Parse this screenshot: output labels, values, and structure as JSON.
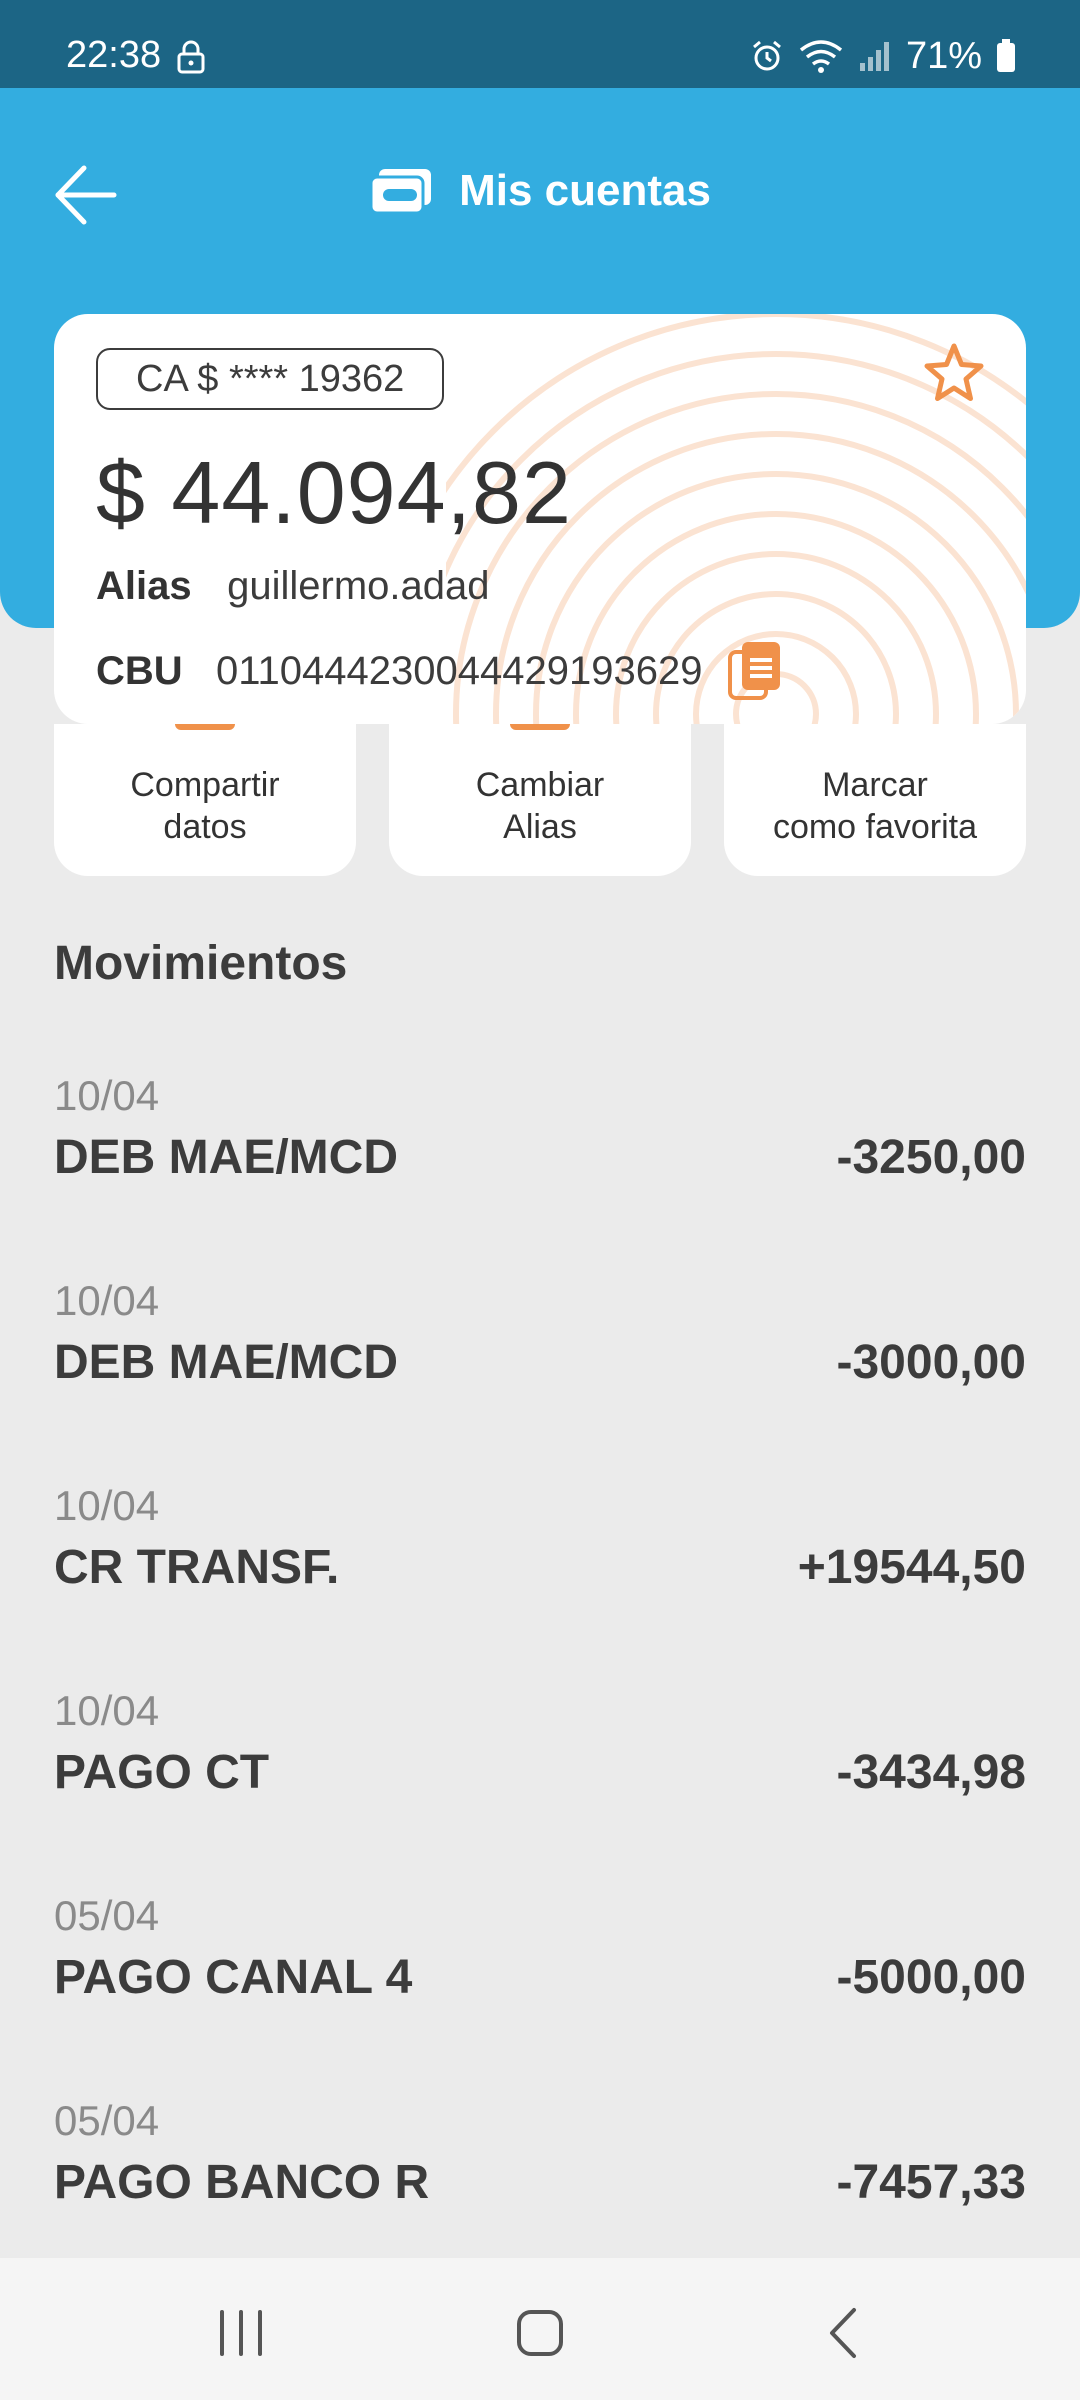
{
  "status_bar": {
    "time": "22:38",
    "battery": "71%"
  },
  "header": {
    "title": "Mis cuentas"
  },
  "account": {
    "id_label": "CA $ **** 19362",
    "balance": "$ 44.094,82",
    "alias_label": "Alias",
    "alias_value": "guillermo.adad",
    "cbu_label": "CBU",
    "cbu_value": "0110444230044429193629"
  },
  "actions": [
    {
      "line1": "Compartir",
      "line2": "datos"
    },
    {
      "line1": "Cambiar",
      "line2": "Alias"
    },
    {
      "line1": "Marcar",
      "line2": "como favorita"
    }
  ],
  "movements_title": "Movimientos",
  "movements": [
    {
      "date": "10/04",
      "description": "DEB MAE/MCD",
      "amount": "-3250,00"
    },
    {
      "date": "10/04",
      "description": "DEB MAE/MCD",
      "amount": "-3000,00"
    },
    {
      "date": "10/04",
      "description": "CR TRANSF.",
      "amount": "+19544,50"
    },
    {
      "date": "10/04",
      "description": "PAGO CT",
      "amount": "-3434,98"
    },
    {
      "date": "05/04",
      "description": "PAGO CANAL 4",
      "amount": "-5000,00"
    },
    {
      "date": "05/04",
      "description": "PAGO BANCO R",
      "amount": "-7457,33"
    }
  ],
  "colors": {
    "status_bar": "#1c6585",
    "header": "#33ade0",
    "accent": "#f0914a",
    "background": "#ebebeb"
  },
  "icons": {
    "back": "arrow-left-icon",
    "account": "card-icon",
    "favorite": "star-icon",
    "copy": "copy-icon",
    "nav_recents": "recents-icon",
    "nav_home": "home-icon",
    "nav_back": "nav-back-icon"
  }
}
